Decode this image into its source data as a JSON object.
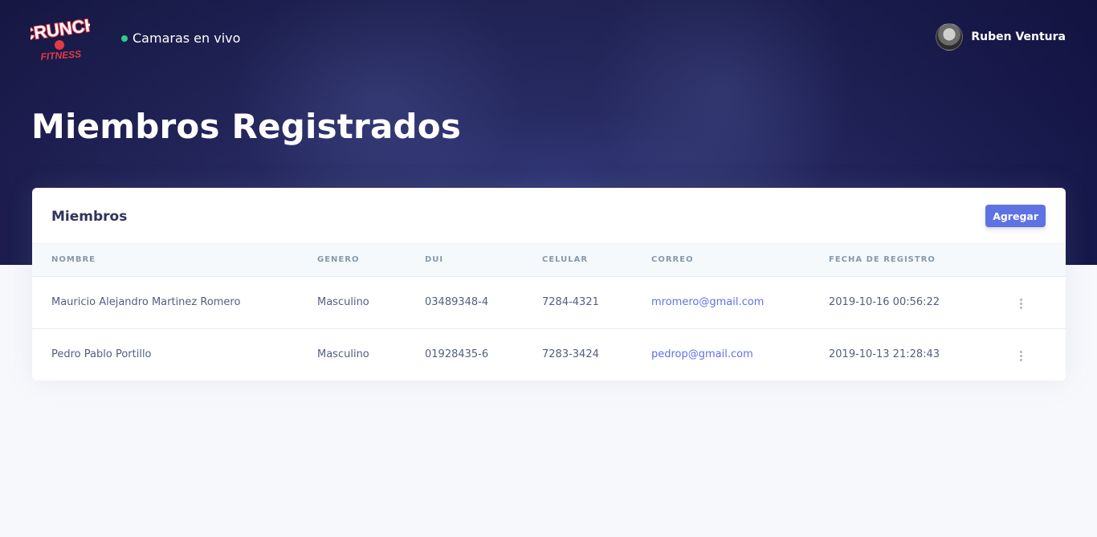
{
  "brand": {
    "logo_name": "Crunch Fitness",
    "logo_top": "CRUNCH",
    "logo_bottom": "FITNESS",
    "accent": "#e63946"
  },
  "nav": {
    "live_label": "Camaras en vivo",
    "live_status_color": "#2dce89"
  },
  "user": {
    "name": "Ruben Ventura"
  },
  "page": {
    "title": "Miembros Registrados"
  },
  "card": {
    "title": "Miembros",
    "add_button": "Agregar",
    "columns": [
      "NOMBRE",
      "GENERO",
      "DUI",
      "CELULAR",
      "CORREO",
      "FECHA DE REGISTRO"
    ],
    "rows": [
      {
        "nombre": "Mauricio Alejandro Martinez Romero",
        "genero": "Masculino",
        "dui": "03489348-4",
        "celular": "7284-4321",
        "correo": "mromero@gmail.com",
        "fecha": "2019-10-16 00:56:22"
      },
      {
        "nombre": "Pedro Pablo Portillo",
        "genero": "Masculino",
        "dui": "01928435-6",
        "celular": "7283-3424",
        "correo": "pedrop@gmail.com",
        "fecha": "2019-10-13 21:28:43"
      }
    ]
  },
  "colors": {
    "primary": "#5e72e4",
    "hero_dark": "#1c1d4e",
    "text": "#525f7f"
  }
}
